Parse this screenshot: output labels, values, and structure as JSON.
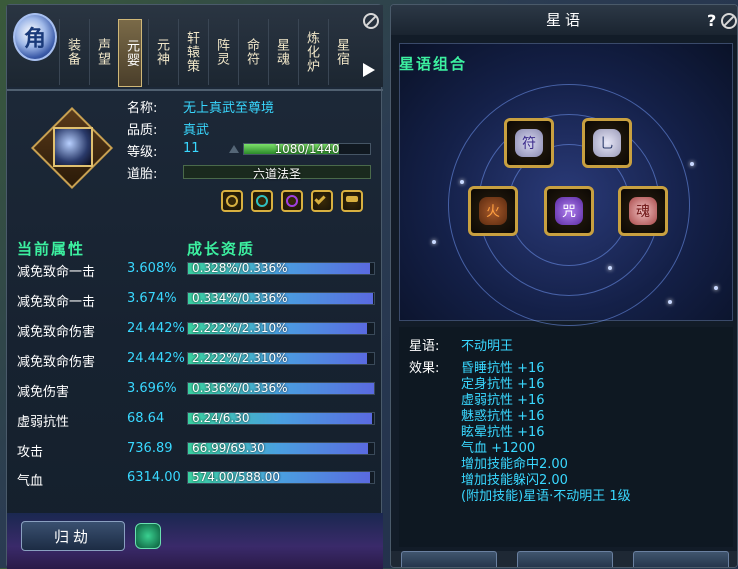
{
  "left_panel": {
    "tabs": [
      "装备",
      "声望",
      "元婴",
      "元神",
      "轩辕策",
      "阵灵",
      "命符",
      "星魂",
      "炼化炉",
      "星宿"
    ],
    "active_tab": 2,
    "logo_glyph": "角",
    "item": {
      "name_label": "名称:",
      "name": "无上真武至尊境",
      "quality_label": "品质:",
      "quality": "真武",
      "level_label": "等级:",
      "level": "11",
      "exp_text": "1080/1440",
      "exp_fraction": 0.75,
      "embryo_label": "道胎:",
      "embryo": "六道法圣"
    },
    "skill_icons": [
      "ring-gold-icon",
      "ring-teal-icon",
      "ring-purple-icon",
      "check-gold-icon",
      "hammer-gold-icon"
    ],
    "current_attr_header": "当前属性",
    "growth_header": "成长资质",
    "attributes": [
      {
        "name": "减免致命一击",
        "value": "3.608%",
        "growth": "0.328%/0.336%",
        "fraction": 0.976
      },
      {
        "name": "减免致命一击",
        "value": "3.674%",
        "growth": "0.334%/0.336%",
        "fraction": 0.994
      },
      {
        "name": "减免致命伤害",
        "value": "24.442%",
        "growth": "2.222%/2.310%",
        "fraction": 0.962
      },
      {
        "name": "减免致命伤害",
        "value": "24.442%",
        "growth": "2.222%/2.310%",
        "fraction": 0.962
      },
      {
        "name": "减免伤害",
        "value": "3.696%",
        "growth": "0.336%/0.336%",
        "fraction": 1.0
      },
      {
        "name": "虚弱抗性",
        "value": "68.64",
        "growth": "6.24/6.30",
        "fraction": 0.99
      },
      {
        "name": "攻击",
        "value": "736.89",
        "growth": "66.99/69.30",
        "fraction": 0.967
      },
      {
        "name": "气血",
        "value": "6314.00",
        "growth": "574.00/588.00",
        "fraction": 0.976
      }
    ],
    "guijie_button": "归劫"
  },
  "right_panel": {
    "title": "星语",
    "help": "?",
    "combo_title": "星语组合",
    "stones": [
      {
        "glyph": "符",
        "color": "#b8b8d8"
      },
      {
        "glyph": "乚",
        "color": "#d8d8e8"
      },
      {
        "glyph": "火",
        "color": "#e07030"
      },
      {
        "glyph": "咒",
        "color": "#9a60e0"
      },
      {
        "glyph": "魂",
        "color": "#e05050"
      }
    ],
    "star_lang_label": "星语:",
    "star_lang_value": "不动明王",
    "effect_label": "效果:",
    "effects": [
      "昏睡抗性 +16",
      "定身抗性 +16",
      "虚弱抗性 +16",
      "魅惑抗性 +16",
      "眩晕抗性 +16",
      "气血 +1200",
      "增加技能命中2.00",
      "增加技能躲闪2.00",
      "(附加技能)星语·不动明王 1级"
    ]
  }
}
